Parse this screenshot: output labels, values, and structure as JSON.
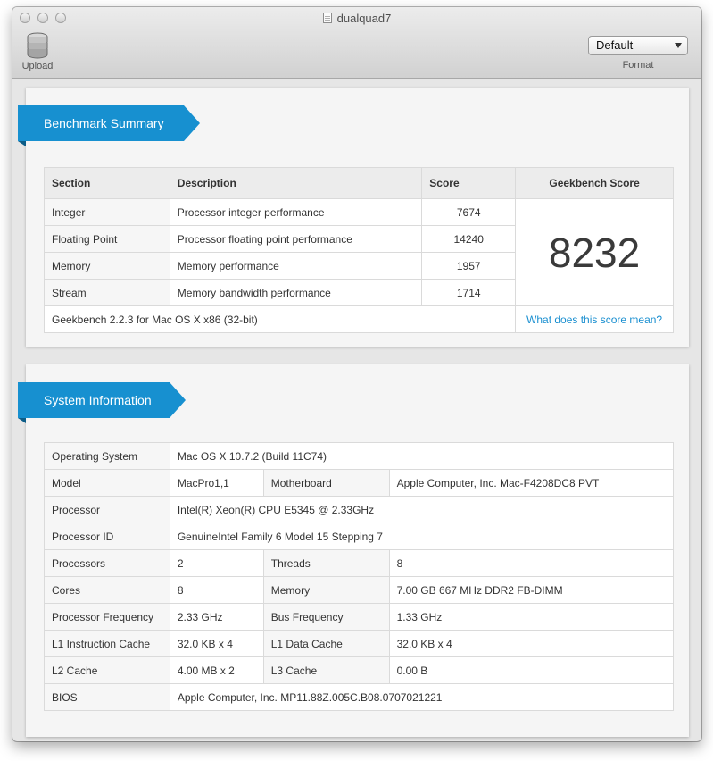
{
  "window": {
    "title": "dualquad7"
  },
  "toolbar": {
    "upload_label": "Upload",
    "format_value": "Default",
    "format_label": "Format"
  },
  "summary": {
    "title": "Benchmark Summary",
    "headers": {
      "section": "Section",
      "description": "Description",
      "score": "Score",
      "gb_score": "Geekbench Score"
    },
    "rows": [
      {
        "section": "Integer",
        "description": "Processor integer performance",
        "score": "7674"
      },
      {
        "section": "Floating Point",
        "description": "Processor floating point performance",
        "score": "14240"
      },
      {
        "section": "Memory",
        "description": "Memory performance",
        "score": "1957"
      },
      {
        "section": "Stream",
        "description": "Memory bandwidth performance",
        "score": "1714"
      }
    ],
    "total": "8232",
    "version": "Geekbench 2.2.3 for Mac OS X x86 (32-bit)",
    "link": "What does this score mean?"
  },
  "system": {
    "title": "System Information",
    "os_label": "Operating System",
    "os": "Mac OS X 10.7.2 (Build 11C74)",
    "model_label": "Model",
    "model": "MacPro1,1",
    "motherboard_label": "Motherboard",
    "motherboard": "Apple Computer, Inc. Mac-F4208DC8 PVT",
    "processor_label": "Processor",
    "processor": "Intel(R) Xeon(R) CPU E5345 @ 2.33GHz",
    "processor_id_label": "Processor ID",
    "processor_id": "GenuineIntel Family 6 Model 15 Stepping 7",
    "processors_label": "Processors",
    "processors": "2",
    "threads_label": "Threads",
    "threads": "8",
    "cores_label": "Cores",
    "cores": "8",
    "memory_label": "Memory",
    "memory": "7.00 GB 667 MHz DDR2 FB-DIMM",
    "freq_label": "Processor Frequency",
    "freq": "2.33 GHz",
    "bus_label": "Bus Frequency",
    "bus": "1.33 GHz",
    "l1i_label": "L1 Instruction Cache",
    "l1i": "32.0 KB x 4",
    "l1d_label": "L1 Data Cache",
    "l1d": "32.0 KB x 4",
    "l2_label": "L2 Cache",
    "l2": "4.00 MB x 2",
    "l3_label": "L3 Cache",
    "l3": "0.00 B",
    "bios_label": "BIOS",
    "bios": "Apple Computer, Inc. MP11.88Z.005C.B08.0707021221"
  }
}
